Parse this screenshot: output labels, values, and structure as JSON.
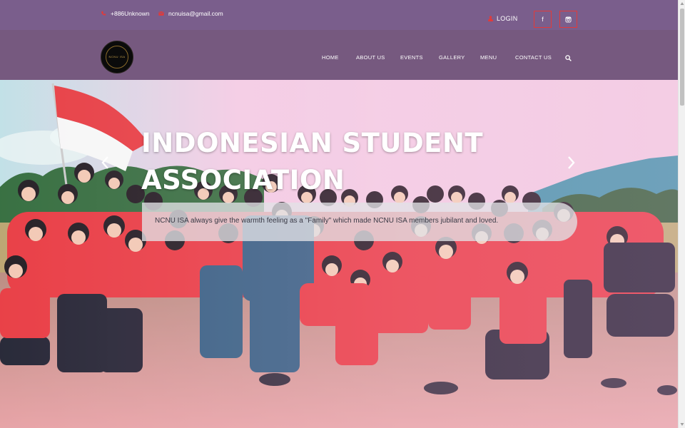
{
  "topbar": {
    "phone": "+886Unknown",
    "email": "ncnuisa@gmail.com",
    "login_label": "LOGIN",
    "social": [
      {
        "icon": "facebook-icon",
        "label": "f"
      },
      {
        "icon": "instagram-icon",
        "label": ""
      }
    ]
  },
  "brand": {
    "logo_text": "NCNU ISA"
  },
  "nav": {
    "items": [
      {
        "label": "HOME"
      },
      {
        "label": "ABOUT US"
      },
      {
        "label": "EVENTS"
      },
      {
        "label": "GALLERY"
      },
      {
        "label": "MENU"
      },
      {
        "label": "CONTACT US"
      }
    ],
    "search_icon": "search-icon"
  },
  "hero": {
    "title_line1": "INDONESIAN STUDENT",
    "title_line2": "ASSOCIATION",
    "caption": "NCNU ISA always give the warmth feeling as a \"Family\" which made NCNU ISA members jubilant and loved.",
    "prev_icon": "chevron-left-icon",
    "next_icon": "chevron-right-icon"
  },
  "colors": {
    "topbar": "#7a5e8c",
    "navbar": "#76597f",
    "social_border": "#e23a3a",
    "accent_red": "#e8393f"
  }
}
